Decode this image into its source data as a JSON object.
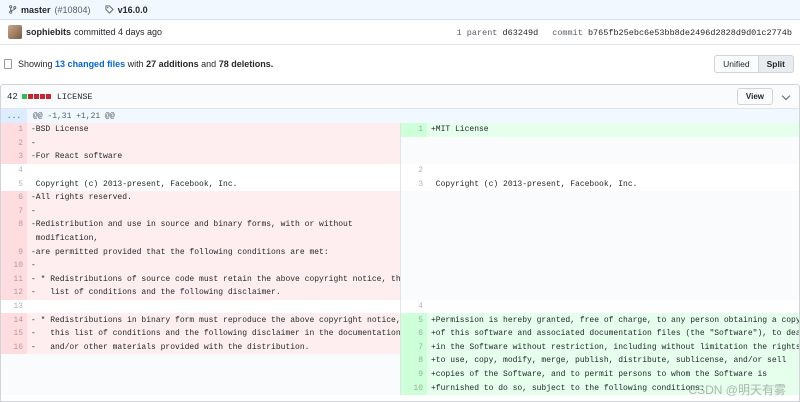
{
  "branch_bar": {
    "branch": "master",
    "pr": "(#10804)",
    "tag": "v16.0.0"
  },
  "commit": {
    "author": "sophiebits",
    "meta": "committed 4 days ago",
    "parent_label": "1 parent",
    "parent_sha": "d63249d",
    "commit_label": "commit",
    "commit_sha": "b765fb25ebc6e53bb8de2496d2828d9d01c2774b"
  },
  "toc": {
    "showing": "Showing",
    "changed_files": "13 changed files",
    "with": "with",
    "additions": "27 additions",
    "and": "and",
    "deletions": "78 deletions.",
    "unified": "Unified",
    "split": "Split"
  },
  "file": {
    "diffstat": "42",
    "name": "LICENSE",
    "view": "View",
    "hunk_expand": "...",
    "hunk_header": "@@ -1,31 +1,21 @@"
  },
  "left_lines": [
    {
      "n": "1",
      "t": "-BSD License",
      "k": "del"
    },
    {
      "n": "2",
      "t": "-",
      "k": "del"
    },
    {
      "n": "3",
      "t": "-For React software",
      "k": "del"
    },
    {
      "n": "4",
      "t": "",
      "k": "ctx"
    },
    {
      "n": "5",
      "t": " Copyright (c) 2013-present, Facebook, Inc.",
      "k": "ctx"
    },
    {
      "n": "6",
      "t": "-All rights reserved.",
      "k": "del"
    },
    {
      "n": "7",
      "t": "-",
      "k": "del"
    },
    {
      "n": "8",
      "t": "-Redistribution and use in source and binary forms, with or without",
      "k": "del"
    },
    {
      "n": "",
      "t": " modification,",
      "k": "del"
    },
    {
      "n": "9",
      "t": "-are permitted provided that the following conditions are met:",
      "k": "del"
    },
    {
      "n": "10",
      "t": "-",
      "k": "del"
    },
    {
      "n": "11",
      "t": "- * Redistributions of source code must retain the above copyright notice, this",
      "k": "del"
    },
    {
      "n": "12",
      "t": "-   list of conditions and the following disclaimer.",
      "k": "del"
    },
    {
      "n": "13",
      "t": "",
      "k": "ctx"
    },
    {
      "n": "14",
      "t": "- * Redistributions in binary form must reproduce the above copyright notice,",
      "k": "del"
    },
    {
      "n": "15",
      "t": "-   this list of conditions and the following disclaimer in the documentation",
      "k": "del"
    },
    {
      "n": "16",
      "t": "-   and/or other materials provided with the distribution.",
      "k": "del"
    },
    {
      "n": "",
      "t": "",
      "k": "empty"
    },
    {
      "n": "",
      "t": "",
      "k": "empty"
    },
    {
      "n": "",
      "t": "",
      "k": "empty"
    }
  ],
  "right_lines": [
    {
      "n": "1",
      "t": "+MIT License",
      "k": "add"
    },
    {
      "n": "",
      "t": "",
      "k": "empty"
    },
    {
      "n": "",
      "t": "",
      "k": "empty"
    },
    {
      "n": "2",
      "t": "",
      "k": "ctx"
    },
    {
      "n": "3",
      "t": " Copyright (c) 2013-present, Facebook, Inc.",
      "k": "ctx"
    },
    {
      "n": "",
      "t": "",
      "k": "empty"
    },
    {
      "n": "",
      "t": "",
      "k": "empty"
    },
    {
      "n": "",
      "t": "",
      "k": "empty"
    },
    {
      "n": "",
      "t": "",
      "k": "empty"
    },
    {
      "n": "",
      "t": "",
      "k": "empty"
    },
    {
      "n": "",
      "t": "",
      "k": "empty"
    },
    {
      "n": "",
      "t": "",
      "k": "empty"
    },
    {
      "n": "",
      "t": "",
      "k": "empty"
    },
    {
      "n": "4",
      "t": "",
      "k": "ctx"
    },
    {
      "n": "5",
      "t": "+Permission is hereby granted, free of charge, to any person obtaining a copy",
      "k": "add"
    },
    {
      "n": "6",
      "t": "+of this software and associated documentation files (the \"Software\"), to deal",
      "k": "add"
    },
    {
      "n": "7",
      "t": "+in the Software without restriction, including without limitation the rights",
      "k": "add"
    },
    {
      "n": "8",
      "t": "+to use, copy, modify, merge, publish, distribute, sublicense, and/or sell",
      "k": "add"
    },
    {
      "n": "9",
      "t": "+copies of the Software, and to permit persons to whom the Software is",
      "k": "add"
    },
    {
      "n": "10",
      "t": "+furnished to do so, subject to the following conditions:",
      "k": "add"
    }
  ],
  "watermark": "CSDN @明天有雾"
}
